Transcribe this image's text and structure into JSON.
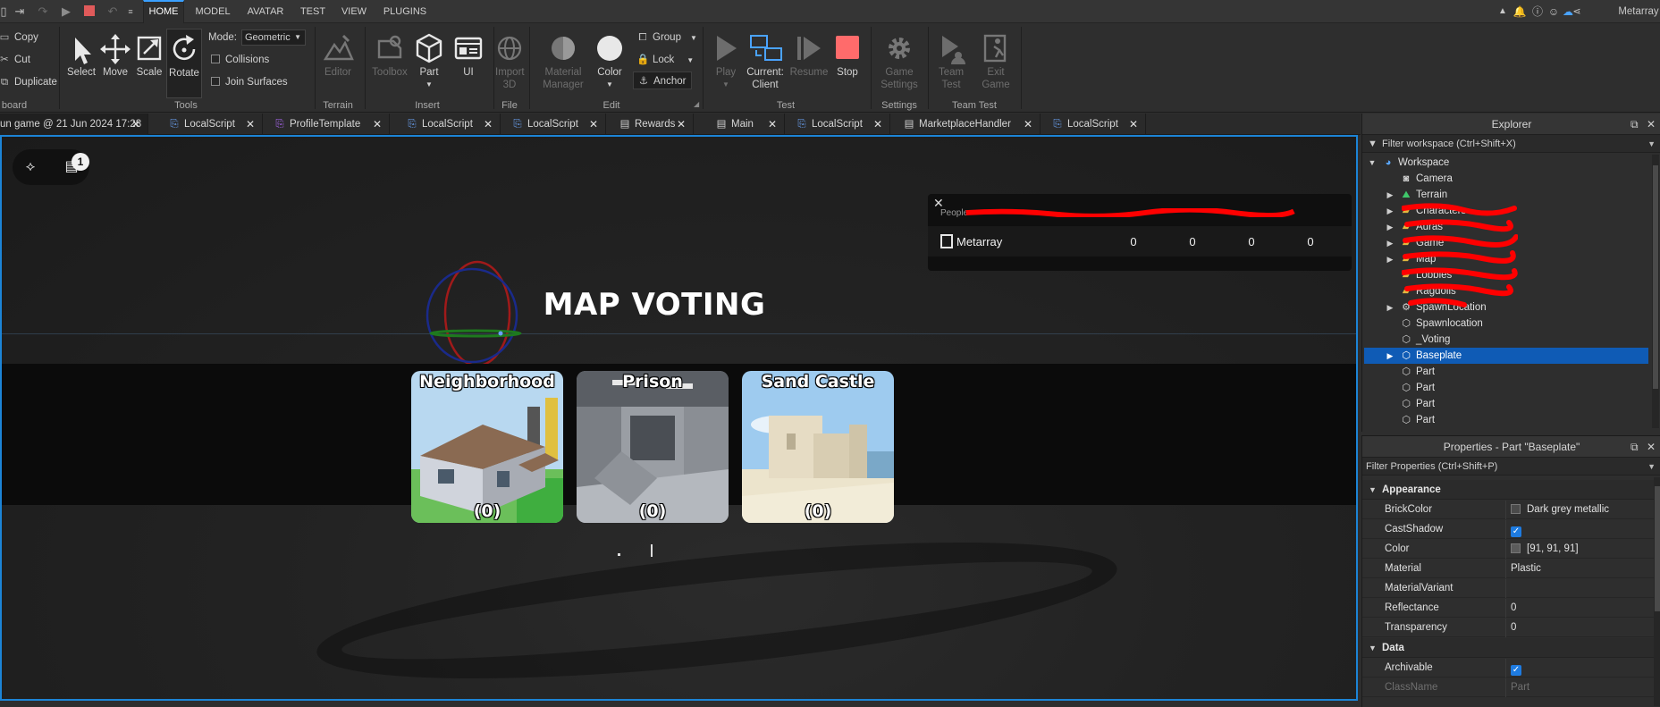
{
  "menubar": {
    "tabs": [
      "HOME",
      "MODEL",
      "AVATAR",
      "TEST",
      "VIEW",
      "PLUGINS"
    ],
    "active_tab": "HOME",
    "user": "Metarray"
  },
  "ribbon": {
    "clipboard": {
      "copy": "Copy",
      "cut": "Cut",
      "duplicate": "Duplicate",
      "group_label": "board"
    },
    "tools": {
      "select": "Select",
      "move": "Move",
      "scale": "Scale",
      "rotate": "Rotate",
      "mode_label": "Mode:",
      "mode_value": "Geometric",
      "collisions": "Collisions",
      "join_surfaces": "Join Surfaces",
      "group_label": "Tools"
    },
    "terrain": {
      "editor": "Editor",
      "group_label": "Terrain"
    },
    "insert": {
      "toolbox": "Toolbox",
      "part": "Part",
      "ui": "UI",
      "group_label": "Insert"
    },
    "file": {
      "import_3d_1": "Import",
      "import_3d_2": "3D",
      "group_label": "File"
    },
    "edit": {
      "material_1": "Material",
      "material_2": "Manager",
      "color": "Color",
      "group": "Group",
      "lock": "Lock",
      "anchor": "Anchor",
      "group_label": "Edit"
    },
    "test": {
      "play": "Play",
      "current_1": "Current:",
      "current_2": "Client",
      "resume": "Resume",
      "stop": "Stop",
      "group_label": "Test"
    },
    "settings": {
      "game_1": "Game",
      "game_2": "Settings",
      "group_label": "Settings"
    },
    "team_test": {
      "team_1": "Team",
      "team_2": "Test",
      "exit_1": "Exit",
      "exit_2": "Game",
      "group_label": "Team Test"
    }
  },
  "doc_tabs": [
    "un game @ 21 Jun 2024 17:28",
    "LocalScript",
    "ProfileTemplate",
    "LocalScript",
    "LocalScript",
    "Rewards",
    "Main",
    "LocalScript",
    "MarketplaceHandler",
    "LocalScript"
  ],
  "viewport": {
    "notification_count": "1",
    "leaderboard": {
      "header": "People",
      "player": "Metarray",
      "values": [
        "0",
        "0",
        "0",
        "0"
      ]
    },
    "vote_title": "MAP VOTING",
    "maps": [
      {
        "name": "Neighborhood",
        "votes": "(0)"
      },
      {
        "name": "Prison",
        "votes": "(0)"
      },
      {
        "name": "Sand Castle",
        "votes": "(0)"
      }
    ]
  },
  "explorer": {
    "title": "Explorer",
    "filter": "Filter workspace (Ctrl+Shift+X)",
    "items": [
      {
        "label": "Workspace",
        "icon": "globe-icon"
      },
      {
        "label": "Camera",
        "icon": "camera-icon"
      },
      {
        "label": "Terrain",
        "icon": "terrain-icon"
      },
      {
        "label": "Characters",
        "icon": "folder-icon"
      },
      {
        "label": "Auras",
        "icon": "folder-icon"
      },
      {
        "label": "Game",
        "icon": "folder-icon"
      },
      {
        "label": "Map",
        "icon": "folder-icon"
      },
      {
        "label": "Lobbies",
        "icon": "folder-icon"
      },
      {
        "label": "Ragdolls",
        "icon": "folder-icon"
      },
      {
        "label": "SpawnLocation",
        "icon": "gear-icon"
      },
      {
        "label": "Spawnlocation",
        "icon": "part-icon"
      },
      {
        "label": "_Voting",
        "icon": "part-icon"
      },
      {
        "label": "Baseplate",
        "icon": "part-icon"
      },
      {
        "label": "Part",
        "icon": "part-icon"
      },
      {
        "label": "Part",
        "icon": "part-icon"
      },
      {
        "label": "Part",
        "icon": "part-icon"
      },
      {
        "label": "Part",
        "icon": "part-icon"
      }
    ]
  },
  "properties": {
    "title": "Properties - Part \"Baseplate\"",
    "filter": "Filter Properties (Ctrl+Shift+P)",
    "sections": {
      "appearance": "Appearance",
      "data": "Data"
    },
    "rows": {
      "brickcolor": {
        "name": "BrickColor",
        "value": "Dark grey metallic",
        "swatch": "#4b4b4b"
      },
      "castshadow": {
        "name": "CastShadow"
      },
      "color": {
        "name": "Color",
        "value": "[91, 91, 91]",
        "swatch": "#5b5b5b"
      },
      "material": {
        "name": "Material",
        "value": "Plastic"
      },
      "materialvariant": {
        "name": "MaterialVariant",
        "value": ""
      },
      "reflectance": {
        "name": "Reflectance",
        "value": "0"
      },
      "transparency": {
        "name": "Transparency",
        "value": "0"
      },
      "archivable": {
        "name": "Archivable"
      },
      "classname": {
        "name": "ClassName",
        "value": "Part"
      }
    }
  }
}
